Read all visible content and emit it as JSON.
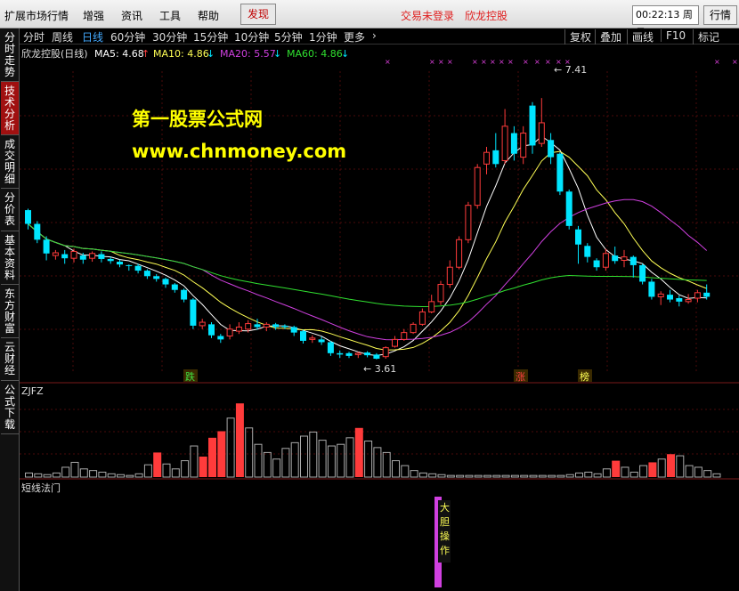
{
  "menu": {
    "items": [
      "扩展市场行情",
      "增强",
      "资讯",
      "工具",
      "帮助"
    ],
    "discover": "发现",
    "login_status": "交易未登录",
    "stock_link": "欣龙控股",
    "clock": "00:22:13 周日",
    "quote_button": "行情"
  },
  "side_tabs": [
    "分时走势",
    "技术分析",
    "成交明细",
    "分价表",
    "基本资料",
    "东方财富",
    "云财经",
    "公式下载"
  ],
  "periods": [
    "分时",
    "周线",
    "日线",
    "60分钟",
    "30分钟",
    "15分钟",
    "10分钟",
    "5分钟",
    "1分钟",
    "更多"
  ],
  "active_period": "日线",
  "more_arrow": "›",
  "tools": [
    "复权",
    "叠加",
    "画线",
    "F10",
    "标记"
  ],
  "main_legend": {
    "title": "欣龙控股(日线)",
    "ma5": "MA5: 4.68",
    "ma10": "MA10: 4.86",
    "ma20": "MA20: 5.57",
    "ma60": "MA60: 4.86",
    "up_arrow": "↑",
    "down_arrow": "↓"
  },
  "watermark": {
    "line1": "第一股票公式网",
    "line2": "www.chnmoney.com"
  },
  "annotations": {
    "high_price": "← 7.41",
    "low_price": "← 3.61",
    "die": "跌",
    "zhang": "涨",
    "bang": "榜"
  },
  "zjfz_label": "ZJFZ",
  "dxfm_label": "短线法门",
  "dxfm_signal": "大胆操作",
  "colors": {
    "up": "#ff3b3b",
    "down": "#00e5ff",
    "ma5": "#ffffff",
    "ma10": "#ffff55",
    "ma20": "#d040e0",
    "ma60": "#30e030",
    "background": "#000000"
  },
  "chart_data": {
    "type": "candlestick",
    "title": "欣龙控股(日线)",
    "ylim": [
      3.4,
      7.8
    ],
    "high_mark": 7.41,
    "low_mark": 3.61,
    "candles": [
      {
        "o": 5.78,
        "c": 5.58,
        "h": 5.8,
        "l": 5.5
      },
      {
        "o": 5.58,
        "c": 5.35,
        "h": 5.62,
        "l": 5.3
      },
      {
        "o": 5.35,
        "c": 5.15,
        "h": 5.4,
        "l": 5.05
      },
      {
        "o": 5.12,
        "c": 5.16,
        "h": 5.2,
        "l": 5.06
      },
      {
        "o": 5.14,
        "c": 5.08,
        "h": 5.2,
        "l": 5.0
      },
      {
        "o": 5.08,
        "c": 5.18,
        "h": 5.22,
        "l": 5.02
      },
      {
        "o": 5.12,
        "c": 5.06,
        "h": 5.16,
        "l": 5.0
      },
      {
        "o": 5.08,
        "c": 5.15,
        "h": 5.18,
        "l": 5.03
      },
      {
        "o": 5.14,
        "c": 5.07,
        "h": 5.18,
        "l": 5.02
      },
      {
        "o": 5.07,
        "c": 5.04,
        "h": 5.1,
        "l": 5.0
      },
      {
        "o": 5.03,
        "c": 4.99,
        "h": 5.06,
        "l": 4.95
      },
      {
        "o": 4.98,
        "c": 4.97,
        "h": 4.99,
        "l": 4.9
      },
      {
        "o": 4.97,
        "c": 4.9,
        "h": 5.0,
        "l": 4.86
      },
      {
        "o": 4.9,
        "c": 4.82,
        "h": 4.92,
        "l": 4.78
      },
      {
        "o": 4.82,
        "c": 4.78,
        "h": 4.85,
        "l": 4.74
      },
      {
        "o": 4.78,
        "c": 4.7,
        "h": 4.8,
        "l": 4.65
      },
      {
        "o": 4.7,
        "c": 4.62,
        "h": 4.72,
        "l": 4.58
      },
      {
        "o": 4.62,
        "c": 4.48,
        "h": 4.64,
        "l": 4.44
      },
      {
        "o": 4.48,
        "c": 4.1,
        "h": 4.5,
        "l": 4.05
      },
      {
        "o": 4.1,
        "c": 4.15,
        "h": 4.2,
        "l": 4.05
      },
      {
        "o": 4.12,
        "c": 3.96,
        "h": 4.15,
        "l": 3.92
      },
      {
        "o": 3.95,
        "c": 3.9,
        "h": 3.98,
        "l": 3.85
      },
      {
        "o": 3.95,
        "c": 4.05,
        "h": 4.12,
        "l": 3.9
      },
      {
        "o": 4.02,
        "c": 4.08,
        "h": 4.15,
        "l": 3.98
      },
      {
        "o": 4.05,
        "c": 4.13,
        "h": 4.18,
        "l": 4.0
      },
      {
        "o": 4.12,
        "c": 4.08,
        "h": 4.2,
        "l": 4.04
      },
      {
        "o": 4.08,
        "c": 4.12,
        "h": 4.15,
        "l": 4.02
      },
      {
        "o": 4.12,
        "c": 4.08,
        "h": 4.14,
        "l": 4.04
      },
      {
        "o": 4.1,
        "c": 4.08,
        "h": 4.12,
        "l": 4.05
      },
      {
        "o": 4.08,
        "c": 4.0,
        "h": 4.1,
        "l": 3.95
      },
      {
        "o": 4.02,
        "c": 3.88,
        "h": 4.04,
        "l": 3.84
      },
      {
        "o": 3.9,
        "c": 3.92,
        "h": 3.96,
        "l": 3.85
      },
      {
        "o": 3.9,
        "c": 3.86,
        "h": 3.94,
        "l": 3.82
      },
      {
        "o": 3.86,
        "c": 3.7,
        "h": 3.88,
        "l": 3.66
      },
      {
        "o": 3.7,
        "c": 3.68,
        "h": 3.74,
        "l": 3.63
      },
      {
        "o": 3.7,
        "c": 3.66,
        "h": 3.72,
        "l": 3.63
      },
      {
        "o": 3.68,
        "c": 3.7,
        "h": 3.72,
        "l": 3.63
      },
      {
        "o": 3.71,
        "c": 3.67,
        "h": 3.73,
        "l": 3.64
      },
      {
        "o": 3.68,
        "c": 3.62,
        "h": 3.7,
        "l": 3.61
      },
      {
        "o": 3.65,
        "c": 3.78,
        "h": 3.8,
        "l": 3.62
      },
      {
        "o": 3.8,
        "c": 3.9,
        "h": 3.95,
        "l": 3.78
      },
      {
        "o": 3.9,
        "c": 4.0,
        "h": 4.05,
        "l": 3.88
      },
      {
        "o": 4.0,
        "c": 4.12,
        "h": 4.15,
        "l": 3.98
      },
      {
        "o": 4.12,
        "c": 4.3,
        "h": 4.35,
        "l": 4.1
      },
      {
        "o": 4.3,
        "c": 4.45,
        "h": 4.55,
        "l": 4.28
      },
      {
        "o": 4.45,
        "c": 4.7,
        "h": 4.75,
        "l": 4.4
      },
      {
        "o": 4.7,
        "c": 4.95,
        "h": 5.05,
        "l": 4.65
      },
      {
        "o": 4.95,
        "c": 5.35,
        "h": 5.4,
        "l": 4.92
      },
      {
        "o": 5.35,
        "c": 5.85,
        "h": 5.9,
        "l": 5.3
      },
      {
        "o": 5.85,
        "c": 6.4,
        "h": 6.45,
        "l": 5.8
      },
      {
        "o": 6.45,
        "c": 6.62,
        "h": 6.7,
        "l": 6.3
      },
      {
        "o": 6.65,
        "c": 6.45,
        "h": 6.9,
        "l": 6.4
      },
      {
        "o": 6.5,
        "c": 7.0,
        "h": 7.25,
        "l": 6.45
      },
      {
        "o": 6.9,
        "c": 6.6,
        "h": 7.0,
        "l": 6.5
      },
      {
        "o": 6.55,
        "c": 6.9,
        "h": 7.0,
        "l": 6.45
      },
      {
        "o": 7.3,
        "c": 6.72,
        "h": 7.35,
        "l": 6.6
      },
      {
        "o": 6.75,
        "c": 7.05,
        "h": 7.41,
        "l": 6.7
      },
      {
        "o": 6.8,
        "c": 6.55,
        "h": 6.9,
        "l": 6.45
      },
      {
        "o": 6.6,
        "c": 6.05,
        "h": 6.62,
        "l": 6.0
      },
      {
        "o": 6.05,
        "c": 5.55,
        "h": 6.08,
        "l": 5.5
      },
      {
        "o": 5.5,
        "c": 5.28,
        "h": 5.55,
        "l": 5.0
      },
      {
        "o": 5.26,
        "c": 5.1,
        "h": 5.3,
        "l": 5.02
      },
      {
        "o": 5.05,
        "c": 4.95,
        "h": 5.08,
        "l": 4.9
      },
      {
        "o": 4.95,
        "c": 5.15,
        "h": 5.22,
        "l": 4.9
      },
      {
        "o": 5.12,
        "c": 5.04,
        "h": 5.25,
        "l": 5.0
      },
      {
        "o": 5.05,
        "c": 5.1,
        "h": 5.2,
        "l": 4.95
      },
      {
        "o": 5.1,
        "c": 4.98,
        "h": 5.12,
        "l": 4.8
      },
      {
        "o": 4.98,
        "c": 4.74,
        "h": 5.0,
        "l": 4.7
      },
      {
        "o": 4.74,
        "c": 4.52,
        "h": 4.78,
        "l": 4.48
      },
      {
        "o": 4.52,
        "c": 4.56,
        "h": 4.6,
        "l": 4.4
      },
      {
        "o": 4.55,
        "c": 4.48,
        "h": 4.62,
        "l": 4.44
      },
      {
        "o": 4.5,
        "c": 4.45,
        "h": 4.54,
        "l": 4.38
      },
      {
        "o": 4.45,
        "c": 4.48,
        "h": 4.56,
        "l": 4.42
      },
      {
        "o": 4.5,
        "c": 4.58,
        "h": 4.62,
        "l": 4.44
      },
      {
        "o": 4.58,
        "c": 4.52,
        "h": 4.7,
        "l": 4.48
      }
    ],
    "zjfz": [
      {
        "v": 0.05,
        "up": false
      },
      {
        "v": 0.04,
        "up": false
      },
      {
        "v": 0.03,
        "up": false
      },
      {
        "v": 0.05,
        "up": false
      },
      {
        "v": 0.12,
        "up": false
      },
      {
        "v": 0.18,
        "up": false
      },
      {
        "v": 0.1,
        "up": false
      },
      {
        "v": 0.08,
        "up": false
      },
      {
        "v": 0.06,
        "up": false
      },
      {
        "v": 0.04,
        "up": false
      },
      {
        "v": 0.03,
        "up": false
      },
      {
        "v": 0.02,
        "up": false
      },
      {
        "v": 0.04,
        "up": false
      },
      {
        "v": 0.15,
        "up": false
      },
      {
        "v": 0.3,
        "up": true
      },
      {
        "v": 0.16,
        "up": false
      },
      {
        "v": 0.1,
        "up": false
      },
      {
        "v": 0.2,
        "up": false
      },
      {
        "v": 0.38,
        "up": false
      },
      {
        "v": 0.25,
        "up": true
      },
      {
        "v": 0.48,
        "up": true
      },
      {
        "v": 0.56,
        "up": true
      },
      {
        "v": 0.72,
        "up": false
      },
      {
        "v": 0.9,
        "up": true
      },
      {
        "v": 0.6,
        "up": false
      },
      {
        "v": 0.4,
        "up": false
      },
      {
        "v": 0.3,
        "up": false
      },
      {
        "v": 0.22,
        "up": false
      },
      {
        "v": 0.35,
        "up": false
      },
      {
        "v": 0.42,
        "up": false
      },
      {
        "v": 0.5,
        "up": false
      },
      {
        "v": 0.55,
        "up": false
      },
      {
        "v": 0.45,
        "up": false
      },
      {
        "v": 0.38,
        "up": false
      },
      {
        "v": 0.4,
        "up": false
      },
      {
        "v": 0.48,
        "up": false
      },
      {
        "v": 0.6,
        "up": true
      },
      {
        "v": 0.44,
        "up": false
      },
      {
        "v": 0.36,
        "up": false
      },
      {
        "v": 0.3,
        "up": false
      },
      {
        "v": 0.2,
        "up": false
      },
      {
        "v": 0.14,
        "up": false
      },
      {
        "v": 0.08,
        "up": false
      },
      {
        "v": 0.05,
        "up": false
      },
      {
        "v": 0.04,
        "up": false
      },
      {
        "v": 0.03,
        "up": false
      },
      {
        "v": 0.02,
        "up": false
      },
      {
        "v": 0.02,
        "up": false
      },
      {
        "v": 0.02,
        "up": false
      },
      {
        "v": 0.02,
        "up": false
      },
      {
        "v": 0.02,
        "up": false
      },
      {
        "v": 0.02,
        "up": false
      },
      {
        "v": 0.02,
        "up": false
      },
      {
        "v": 0.02,
        "up": false
      },
      {
        "v": 0.02,
        "up": false
      },
      {
        "v": 0.02,
        "up": false
      },
      {
        "v": 0.02,
        "up": false
      },
      {
        "v": 0.02,
        "up": false
      },
      {
        "v": 0.02,
        "up": false
      },
      {
        "v": 0.03,
        "up": false
      },
      {
        "v": 0.05,
        "up": false
      },
      {
        "v": 0.06,
        "up": false
      },
      {
        "v": 0.04,
        "up": false
      },
      {
        "v": 0.1,
        "up": false
      },
      {
        "v": 0.2,
        "up": true
      },
      {
        "v": 0.12,
        "up": false
      },
      {
        "v": 0.06,
        "up": false
      },
      {
        "v": 0.14,
        "up": false
      },
      {
        "v": 0.18,
        "up": true
      },
      {
        "v": 0.22,
        "up": false
      },
      {
        "v": 0.28,
        "up": true
      },
      {
        "v": 0.26,
        "up": false
      },
      {
        "v": 0.14,
        "up": false
      },
      {
        "v": 0.12,
        "up": false
      },
      {
        "v": 0.08,
        "up": false
      },
      {
        "v": 0.04,
        "up": false
      }
    ]
  }
}
